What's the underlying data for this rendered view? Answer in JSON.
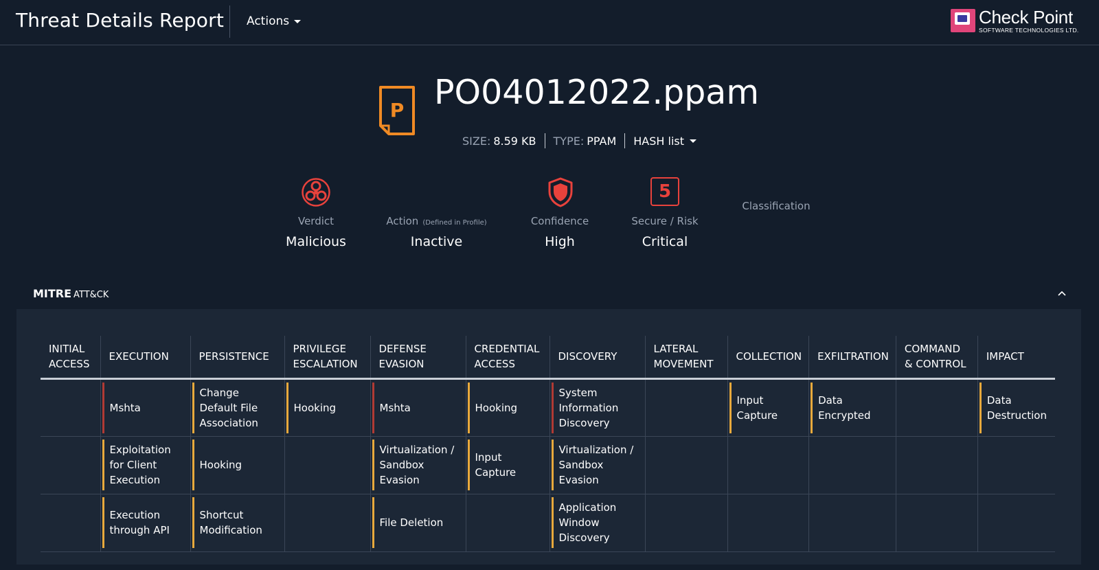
{
  "header": {
    "title": "Threat Details Report",
    "actions_label": "Actions",
    "logo_name": "Check Point",
    "logo_sub": "SOFTWARE TECHNOLOGIES LTD."
  },
  "file": {
    "icon_letter": "P",
    "name": "PO04012022.ppam",
    "size_key": "SIZE:",
    "size_value": "8.59 KB",
    "type_key": "TYPE:",
    "type_value": "PPAM",
    "hash_label": "HASH list"
  },
  "summary": {
    "verdict": {
      "label": "Verdict",
      "value": "Malicious"
    },
    "action": {
      "label": "Action",
      "note": "(Defined in Profile)",
      "value": "Inactive"
    },
    "confidence": {
      "label": "Confidence",
      "value": "High"
    },
    "risk": {
      "score": "5",
      "label": "Secure / Risk",
      "value": "Critical"
    },
    "classification": {
      "label": "Classification"
    }
  },
  "mitre": {
    "title": "MITRE",
    "title_suffix": "ATT&CK",
    "columns": [
      {
        "label": "INITIAL ACCESS",
        "techniques": []
      },
      {
        "label": "EXECUTION",
        "techniques": [
          {
            "name": "Mshta",
            "severity": "red"
          },
          {
            "name": "Exploitation for Client Execution",
            "severity": "orange"
          },
          {
            "name": "Execution through API",
            "severity": "orange"
          }
        ]
      },
      {
        "label": "PERSISTENCE",
        "techniques": [
          {
            "name": "Change Default File Association",
            "severity": "orange"
          },
          {
            "name": "Hooking",
            "severity": "orange"
          },
          {
            "name": "Shortcut Modification",
            "severity": "orange"
          }
        ]
      },
      {
        "label": "PRIVILEGE ESCALATION",
        "techniques": [
          {
            "name": "Hooking",
            "severity": "orange"
          }
        ]
      },
      {
        "label": "DEFENSE EVASION",
        "techniques": [
          {
            "name": "Mshta",
            "severity": "red"
          },
          {
            "name": "Virtualization / Sandbox Evasion",
            "severity": "orange"
          },
          {
            "name": "File Deletion",
            "severity": "orange"
          }
        ]
      },
      {
        "label": "CREDENTIAL ACCESS",
        "techniques": [
          {
            "name": "Hooking",
            "severity": "orange"
          },
          {
            "name": "Input Capture",
            "severity": "orange"
          }
        ]
      },
      {
        "label": "DISCOVERY",
        "techniques": [
          {
            "name": "System Information Discovery",
            "severity": "red"
          },
          {
            "name": "Virtualization / Sandbox Evasion",
            "severity": "orange"
          },
          {
            "name": "Application Window Discovery",
            "severity": "orange"
          }
        ]
      },
      {
        "label": "LATERAL MOVEMENT",
        "techniques": []
      },
      {
        "label": "COLLECTION",
        "techniques": [
          {
            "name": "Input Capture",
            "severity": "orange"
          }
        ]
      },
      {
        "label": "EXFILTRATION",
        "techniques": [
          {
            "name": "Data Encrypted",
            "severity": "orange"
          }
        ]
      },
      {
        "label": "COMMAND & CONTROL",
        "techniques": []
      },
      {
        "label": "IMPACT",
        "techniques": [
          {
            "name": "Data Destruction",
            "severity": "orange"
          }
        ]
      }
    ]
  },
  "colors": {
    "background": "#131d2b",
    "panel": "#1c2736",
    "accent_orange": "#f08a24",
    "severity_red": "#b03a34",
    "severity_orange": "#e8a93c",
    "risk_red": "#e8423c"
  }
}
